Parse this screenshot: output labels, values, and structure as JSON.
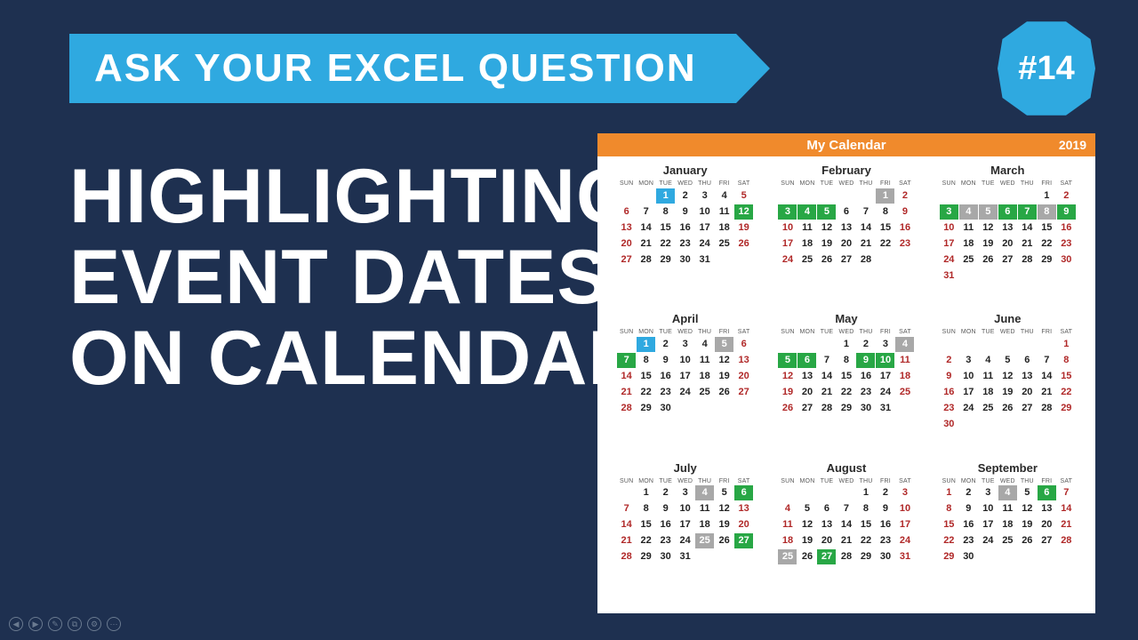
{
  "banner": {
    "title": "ASK YOUR EXCEL QUESTION"
  },
  "badge": {
    "label": "#14"
  },
  "main_title": {
    "line1": "HIGHLIGHTING",
    "line2": "EVENT DATES",
    "line3": "ON CALENDAR"
  },
  "calendar": {
    "title": "My  Calendar",
    "year": "2019",
    "dows": [
      "SUN",
      "MON",
      "TUE",
      "WED",
      "THU",
      "FRI",
      "SAT"
    ],
    "months": [
      {
        "name": "January",
        "start": 2,
        "ndays": 31,
        "highlights": {
          "1": "blue",
          "12": "green"
        }
      },
      {
        "name": "February",
        "start": 5,
        "ndays": 28,
        "highlights": {
          "1": "gray",
          "3": "green",
          "4": "green",
          "5": "green"
        }
      },
      {
        "name": "March",
        "start": 5,
        "ndays": 31,
        "highlights": {
          "3": "green",
          "4": "gray",
          "5": "gray",
          "6": "green",
          "7": "green",
          "8": "gray",
          "9": "green"
        }
      },
      {
        "name": "April",
        "start": 1,
        "ndays": 30,
        "highlights": {
          "1": "blue",
          "5": "gray",
          "7": "green"
        }
      },
      {
        "name": "May",
        "start": 3,
        "ndays": 31,
        "highlights": {
          "4": "gray",
          "5": "green",
          "6": "green",
          "9": "green",
          "10": "green"
        }
      },
      {
        "name": "June",
        "start": 6,
        "ndays": 30,
        "highlights": {}
      },
      {
        "name": "July",
        "start": 1,
        "ndays": 31,
        "highlights": {
          "4": "gray",
          "6": "green",
          "25": "gray",
          "27": "green"
        }
      },
      {
        "name": "August",
        "start": 4,
        "ndays": 31,
        "highlights": {
          "25": "gray",
          "27": "green"
        }
      },
      {
        "name": "September",
        "start": 0,
        "ndays": 30,
        "highlights": {
          "4": "gray",
          "6": "green"
        }
      }
    ]
  },
  "nav": [
    "◀",
    "▶",
    "✎",
    "⧉",
    "⚙",
    "⋯"
  ]
}
